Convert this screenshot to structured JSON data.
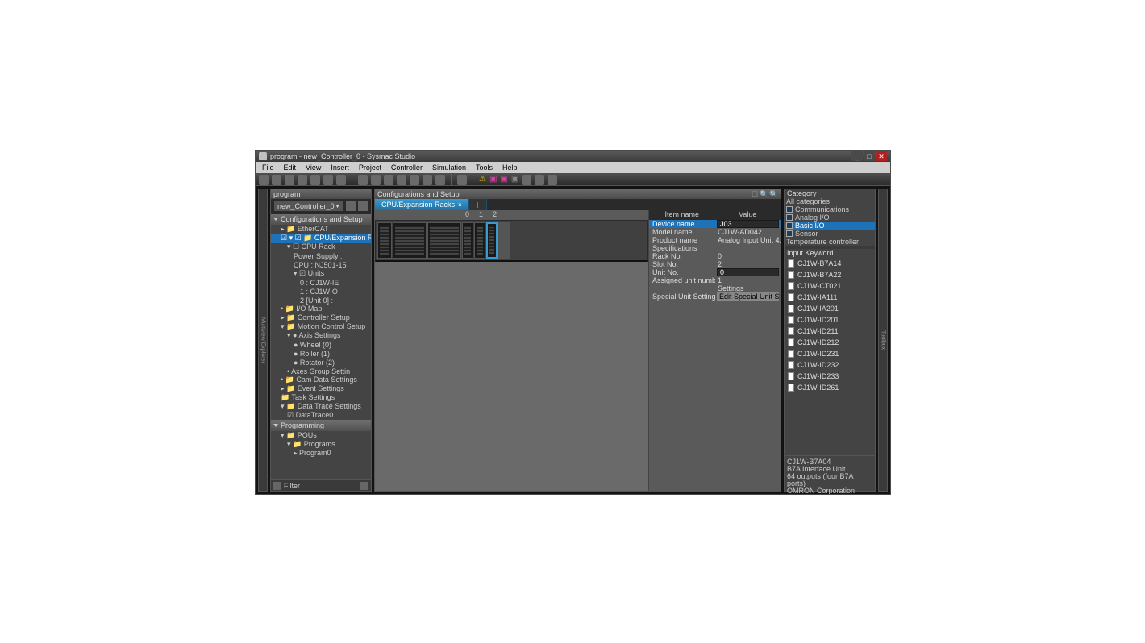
{
  "window": {
    "title": "program - new_Controller_0 - Sysmac Studio"
  },
  "menu": [
    "File",
    "Edit",
    "View",
    "Insert",
    "Project",
    "Controller",
    "Simulation",
    "Tools",
    "Help"
  ],
  "left_panel": {
    "title": "program",
    "controller": "new_Controller_0",
    "vert_label": "Multiview Explorer",
    "sections": {
      "config": "Configurations and Setup",
      "prog": "Programming"
    },
    "tree": [
      {
        "lvl": 1,
        "t": "▸ 📁 EtherCAT"
      },
      {
        "lvl": 1,
        "t": "☑ ▾ ☑ 📁 CPU/Expansion Racks",
        "sel": true
      },
      {
        "lvl": 2,
        "t": "▾ ☐ CPU Rack"
      },
      {
        "lvl": 3,
        "t": "Power Supply :"
      },
      {
        "lvl": 3,
        "t": "CPU : NJ501-15"
      },
      {
        "lvl": 3,
        "t": "▾ ☑ Units"
      },
      {
        "lvl": 4,
        "t": "0 : CJ1W-IE"
      },
      {
        "lvl": 4,
        "t": "1 : CJ1W-O"
      },
      {
        "lvl": 4,
        "t": "2 [Unit 0] :"
      },
      {
        "lvl": 1,
        "t": "• 📁 I/O Map"
      },
      {
        "lvl": 1,
        "t": "▸ 📁 Controller Setup"
      },
      {
        "lvl": 1,
        "t": "▾ 📁 Motion Control Setup"
      },
      {
        "lvl": 2,
        "t": "▾ ● Axis Settings"
      },
      {
        "lvl": 3,
        "t": "● Wheel (0)"
      },
      {
        "lvl": 3,
        "t": "● Roller (1)"
      },
      {
        "lvl": 3,
        "t": "● Rotator (2)"
      },
      {
        "lvl": 2,
        "t": "• Axes Group Settin"
      },
      {
        "lvl": 1,
        "t": "• 📁 Cam Data Settings"
      },
      {
        "lvl": 1,
        "t": "▸ 📁 Event Settings"
      },
      {
        "lvl": 1,
        "t": "📁 Task Settings"
      },
      {
        "lvl": 1,
        "t": "▾ 📁 Data Trace Settings"
      },
      {
        "lvl": 2,
        "t": "☑ DataTrace0"
      }
    ],
    "prog_tree": [
      {
        "lvl": 1,
        "t": "▾ 📁 POUs"
      },
      {
        "lvl": 2,
        "t": "▾ 📁 Programs"
      },
      {
        "lvl": 3,
        "t": "▸ Program0"
      }
    ],
    "filter_label": "Filter"
  },
  "center": {
    "header": "Configurations and Setup",
    "tab": "CPU/Expansion Racks",
    "slots": [
      "0",
      "1",
      "2"
    ]
  },
  "props": {
    "hdr_item": "Item name",
    "hdr_value": "Value",
    "rows": [
      {
        "k": "Device name",
        "v": "J03",
        "sel": true,
        "input": true
      },
      {
        "k": "Model name",
        "v": "CJ1W-AD042"
      },
      {
        "k": "Product name",
        "v": "Analog Input Unit  4..."
      },
      {
        "k": "Specifications",
        "v": ""
      },
      {
        "k": "Rack No.",
        "v": "0"
      },
      {
        "k": "Slot No.",
        "v": "2"
      },
      {
        "k": "Unit No.",
        "v": "0",
        "input": true
      },
      {
        "k": "Assigned unit numbers",
        "v": "1"
      },
      {
        "k": "",
        "v": "Settings"
      },
      {
        "k": "Special Unit Settings",
        "v": "Edit Special Unit Se",
        "btn": true
      }
    ]
  },
  "right": {
    "cat_header": "Category",
    "categories": [
      {
        "t": "All categories"
      },
      {
        "t": "Communications",
        "ic": true
      },
      {
        "t": "Analog I/O",
        "ic": true
      },
      {
        "t": "Basic I/O",
        "ic": true,
        "sel": true
      },
      {
        "t": "Sensor",
        "ic": true
      },
      {
        "t": "Temperature controller"
      }
    ],
    "kw_header": "Input Keyword",
    "devices": [
      "CJ1W-B7A14",
      "CJ1W-B7A22",
      "CJ1W-CT021",
      "CJ1W-IA111",
      "CJ1W-IA201",
      "CJ1W-ID201",
      "CJ1W-ID211",
      "CJ1W-ID212",
      "CJ1W-ID231",
      "CJ1W-ID232",
      "CJ1W-ID233",
      "CJ1W-ID261"
    ],
    "info": {
      "name": "CJ1W-B7A04",
      "desc1": "B7A Interface Unit",
      "desc2": "64 outputs (four B7A ports)",
      "vendor": "OMRON Corporation"
    },
    "vert_label": "Toolbox"
  }
}
